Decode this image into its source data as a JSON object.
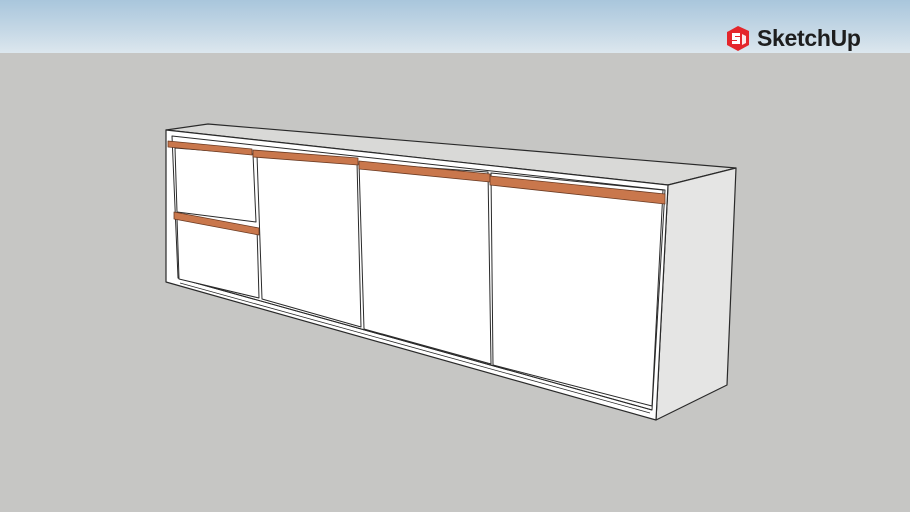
{
  "app": {
    "brand": "SketchUp",
    "logo_icon": "sketchup-logo-icon",
    "brand_color": "#e4262b"
  },
  "model": {
    "object": "sideboard-cabinet",
    "drawer_count": 2,
    "door_count": 3,
    "handle_color": "#c9774c",
    "body_color": "#ffffff",
    "top_color": "#d8d8d6",
    "side_color": "#e6e6e5"
  }
}
